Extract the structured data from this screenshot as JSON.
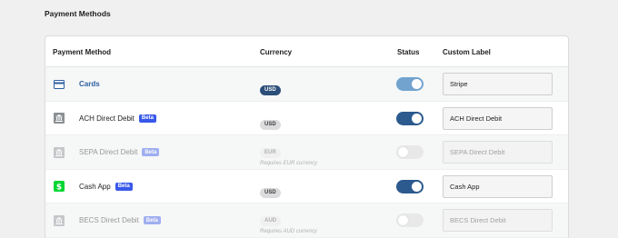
{
  "section_title": "Payment Methods",
  "table": {
    "headers": {
      "method": "Payment Method",
      "currency": "Currency",
      "status": "Status",
      "custom_label": "Custom Label"
    }
  },
  "rows": [
    {
      "name": "Cards",
      "icon": "credit-card-icon",
      "beta": null,
      "currency": "USD",
      "currency_note": null,
      "status": "on",
      "custom_label": "Stripe"
    },
    {
      "name": "ACH Direct Debit",
      "icon": "bank-icon",
      "beta": "Beta",
      "currency": "USD",
      "currency_note": null,
      "status": "on",
      "custom_label": "ACH Direct Debit"
    },
    {
      "name": "SEPA Direct Debit",
      "icon": "bank-icon",
      "beta": "Beta",
      "currency": "EUR",
      "currency_note": "Requires EUR currency",
      "status": "off",
      "custom_label": "SEPA Direct Debit"
    },
    {
      "name": "Cash App",
      "icon": "cash-app-icon",
      "beta": "Beta",
      "currency": "USD",
      "currency_note": null,
      "status": "on",
      "custom_label": "Cash App"
    },
    {
      "name": "BECS Direct Debit",
      "icon": "bank-icon",
      "beta": "Beta",
      "currency": "AUD",
      "currency_note": "Requires AUD currency",
      "status": "off",
      "custom_label": "BECS Direct Debit"
    }
  ],
  "colors": {
    "link": "#2c5fa0",
    "beta": "#3858e9",
    "toggle_on": "#2c5a8e",
    "cash_app": "#00d632"
  }
}
